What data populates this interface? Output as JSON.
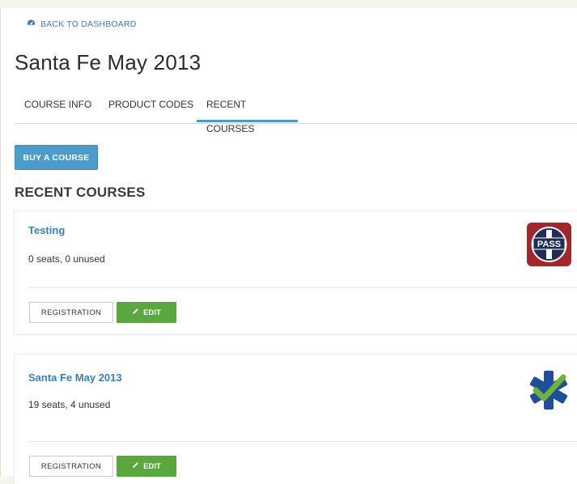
{
  "nav": {
    "back_label": "BACK TO DASHBOARD"
  },
  "page": {
    "title": "Santa Fe May 2013"
  },
  "tabs": [
    {
      "label": "COURSE INFO",
      "active": false
    },
    {
      "label": "PRODUCT CODES",
      "active": false
    },
    {
      "label": "RECENT COURSES",
      "active": true
    }
  ],
  "buy_button": "BUY A COURSE",
  "section_title": "RECENT COURSES",
  "courses": [
    {
      "title": "Testing",
      "seats": "0 seats, 0 unused",
      "registration_label": "REGISTRATION",
      "edit_label": "EDIT",
      "logo_icon": "pass-badge-icon",
      "logo_text": "PASS"
    },
    {
      "title": "Santa Fe May 2013",
      "seats": "19 seats, 4 unused",
      "registration_label": "REGISTRATION",
      "edit_label": "EDIT",
      "logo_icon": "star-of-life-check-icon"
    }
  ],
  "colors": {
    "accent_blue": "#4b9ccc",
    "link_blue": "#3b7fb8",
    "edit_green": "#5aa83d",
    "pass_red": "#a3262b"
  }
}
